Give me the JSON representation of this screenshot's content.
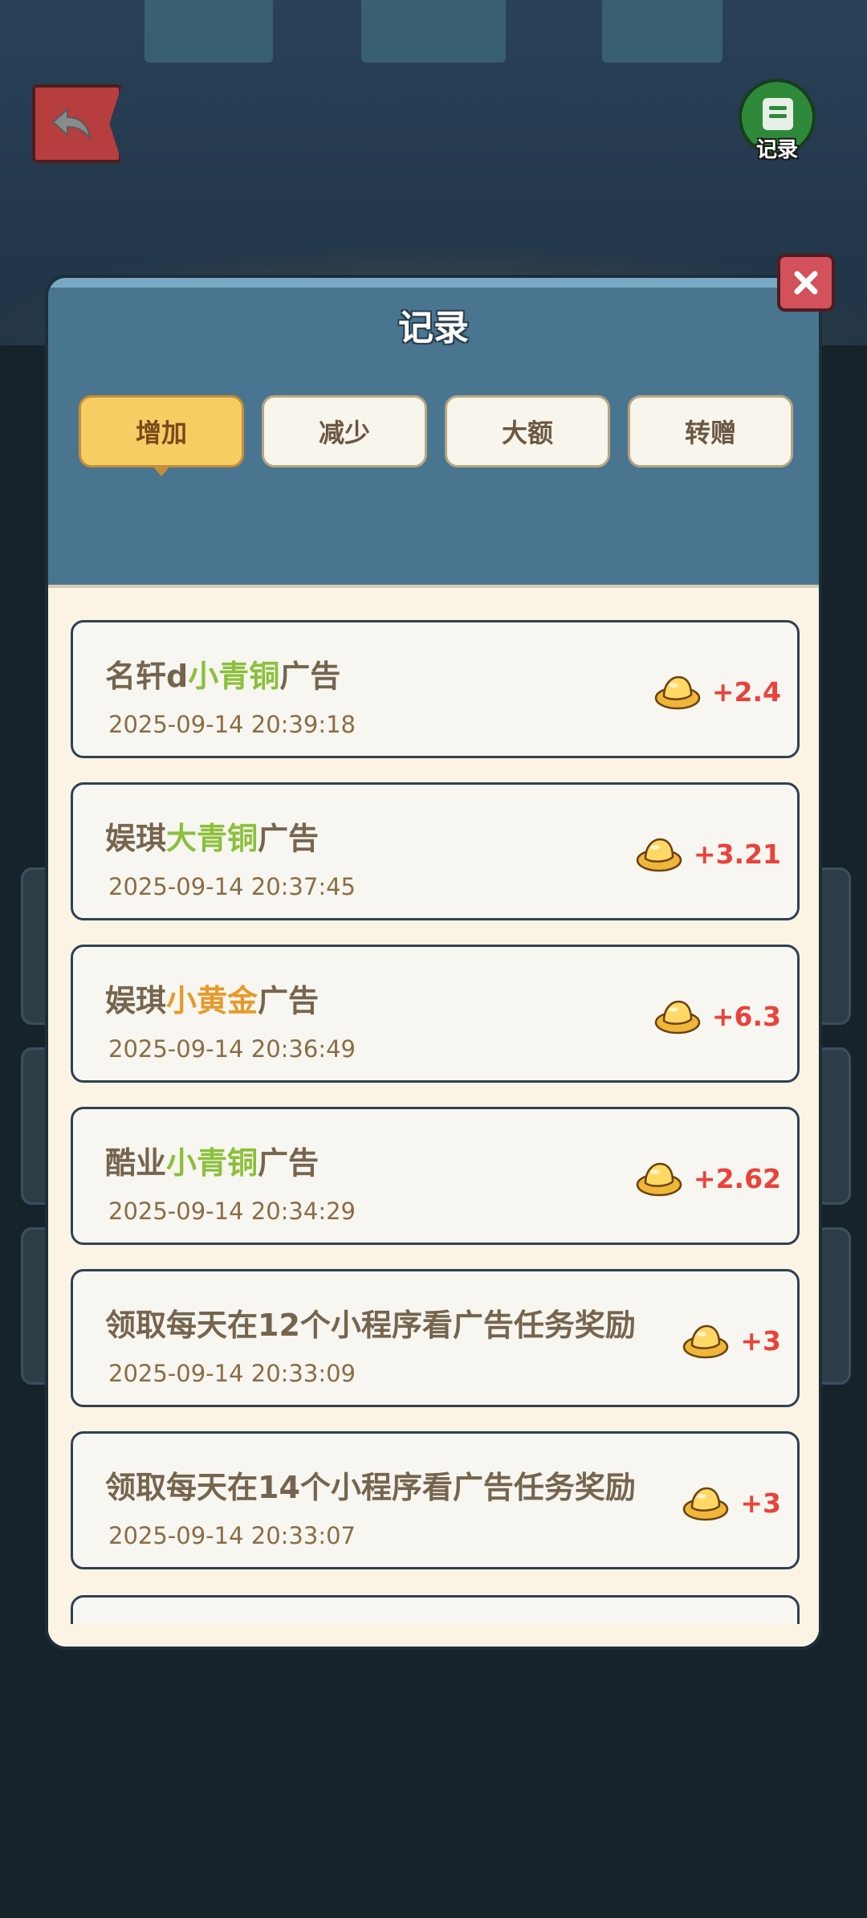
{
  "modal": {
    "title": "记录",
    "close_label": "×"
  },
  "top": {
    "record_label": "记录"
  },
  "tabs": [
    {
      "label": "增加",
      "active": true
    },
    {
      "label": "减少",
      "active": false
    },
    {
      "label": "大额",
      "active": false
    },
    {
      "label": "转赠",
      "active": false
    }
  ],
  "records": [
    {
      "prefix": "名轩d",
      "highlight": "小青铜",
      "suffix": "广告",
      "highlight_color": "green",
      "time": "2025-09-14 20:39:18",
      "amount": "+2.4"
    },
    {
      "prefix": "娱琪",
      "highlight": "大青铜",
      "suffix": "广告",
      "highlight_color": "green",
      "time": "2025-09-14 20:37:45",
      "amount": "+3.21"
    },
    {
      "prefix": "娱琪",
      "highlight": "小黄金",
      "suffix": "广告",
      "highlight_color": "orange",
      "time": "2025-09-14 20:36:49",
      "amount": "+6.3"
    },
    {
      "prefix": "酷业",
      "highlight": "小青铜",
      "suffix": "广告",
      "highlight_color": "green",
      "time": "2025-09-14 20:34:29",
      "amount": "+2.62"
    },
    {
      "prefix": "领取每天在12个小程序看广告任务奖励",
      "highlight": "",
      "suffix": "",
      "highlight_color": "",
      "time": "2025-09-14 20:33:09",
      "amount": "+3"
    },
    {
      "prefix": "领取每天在14个小程序看广告任务奖励",
      "highlight": "",
      "suffix": "",
      "highlight_color": "",
      "time": "2025-09-14 20:33:07",
      "amount": "+3"
    }
  ],
  "colors": {
    "green_highlight": "#8cbf3c",
    "orange_highlight": "#e69a2a",
    "amount": "#e9423a",
    "modal_header": "#4a7590",
    "active_tab": "#f6cd63"
  }
}
